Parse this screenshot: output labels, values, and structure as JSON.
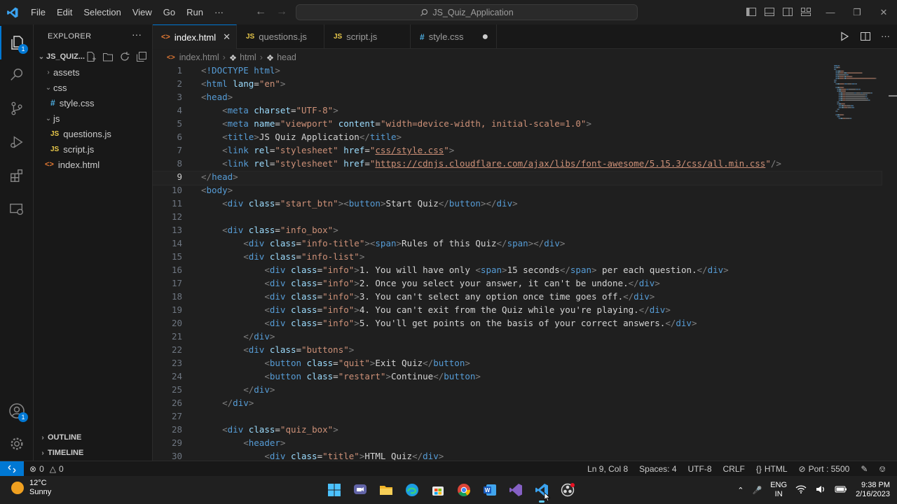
{
  "titlebar": {
    "menu": [
      "File",
      "Edit",
      "Selection",
      "View",
      "Go",
      "Run",
      "···"
    ],
    "search": "JS_Quiz_Application"
  },
  "activity": {
    "explorer_badge": "1",
    "account_badge": "1"
  },
  "explorer": {
    "title": "EXPLORER",
    "project": "JS_QUIZ...",
    "items": [
      {
        "label": "assets",
        "kind": "folder",
        "open": false,
        "depth": 1
      },
      {
        "label": "css",
        "kind": "folder",
        "open": true,
        "depth": 1
      },
      {
        "label": "style.css",
        "kind": "css",
        "depth": 2
      },
      {
        "label": "js",
        "kind": "folder",
        "open": true,
        "depth": 1
      },
      {
        "label": "questions.js",
        "kind": "js",
        "depth": 2
      },
      {
        "label": "script.js",
        "kind": "js",
        "depth": 2
      },
      {
        "label": "index.html",
        "kind": "html",
        "depth": 1
      }
    ],
    "outline": "OUTLINE",
    "timeline": "TIMELINE"
  },
  "tabs": [
    {
      "label": "index.html",
      "kind": "html",
      "active": true
    },
    {
      "label": "questions.js",
      "kind": "js"
    },
    {
      "label": "script.js",
      "kind": "js"
    },
    {
      "label": "style.css",
      "kind": "css",
      "dirty": true
    }
  ],
  "breadcrumbs": [
    "index.html",
    "html",
    "head"
  ],
  "editor": {
    "current_line": 9,
    "lines": [
      [
        [
          "tag",
          "<"
        ],
        [
          "name",
          "!DOCTYPE"
        ],
        [
          "txt",
          " "
        ],
        [
          "name",
          "html"
        ],
        [
          "tag",
          ">"
        ]
      ],
      [
        [
          "tag",
          "<"
        ],
        [
          "name",
          "html"
        ],
        [
          "txt",
          " "
        ],
        [
          "attr",
          "lang"
        ],
        [
          "txt",
          "="
        ],
        [
          "val",
          "\"en\""
        ],
        [
          "tag",
          ">"
        ]
      ],
      [
        [
          "tag",
          "<"
        ],
        [
          "name",
          "head"
        ],
        [
          "tag",
          ">"
        ]
      ],
      [
        [
          "txt",
          "    "
        ],
        [
          "tag",
          "<"
        ],
        [
          "name",
          "meta"
        ],
        [
          "txt",
          " "
        ],
        [
          "attr",
          "charset"
        ],
        [
          "txt",
          "="
        ],
        [
          "val",
          "\"UTF-8\""
        ],
        [
          "tag",
          ">"
        ]
      ],
      [
        [
          "txt",
          "    "
        ],
        [
          "tag",
          "<"
        ],
        [
          "name",
          "meta"
        ],
        [
          "txt",
          " "
        ],
        [
          "attr",
          "name"
        ],
        [
          "txt",
          "="
        ],
        [
          "val",
          "\"viewport\""
        ],
        [
          "txt",
          " "
        ],
        [
          "attr",
          "content"
        ],
        [
          "txt",
          "="
        ],
        [
          "val",
          "\"width=device-width, initial-scale=1.0\""
        ],
        [
          "tag",
          ">"
        ]
      ],
      [
        [
          "txt",
          "    "
        ],
        [
          "tag",
          "<"
        ],
        [
          "name",
          "title"
        ],
        [
          "tag",
          ">"
        ],
        [
          "txt",
          "JS Quiz Application"
        ],
        [
          "tag",
          "</"
        ],
        [
          "name",
          "title"
        ],
        [
          "tag",
          ">"
        ]
      ],
      [
        [
          "txt",
          "    "
        ],
        [
          "tag",
          "<"
        ],
        [
          "name",
          "link"
        ],
        [
          "txt",
          " "
        ],
        [
          "attr",
          "rel"
        ],
        [
          "txt",
          "="
        ],
        [
          "val",
          "\"stylesheet\""
        ],
        [
          "txt",
          " "
        ],
        [
          "attr",
          "href"
        ],
        [
          "txt",
          "="
        ],
        [
          "val",
          "\""
        ],
        [
          "valu",
          "css/style.css"
        ],
        [
          "val",
          "\""
        ],
        [
          "tag",
          ">"
        ]
      ],
      [
        [
          "txt",
          "    "
        ],
        [
          "tag",
          "<"
        ],
        [
          "name",
          "link"
        ],
        [
          "txt",
          " "
        ],
        [
          "attr",
          "rel"
        ],
        [
          "txt",
          "="
        ],
        [
          "val",
          "\"stylesheet\""
        ],
        [
          "txt",
          " "
        ],
        [
          "attr",
          "href"
        ],
        [
          "txt",
          "="
        ],
        [
          "val",
          "\""
        ],
        [
          "valu",
          "https://cdnjs.cloudflare.com/ajax/libs/font-awesome/5.15.3/css/all.min.css"
        ],
        [
          "val",
          "\""
        ],
        [
          "tag",
          "/>"
        ]
      ],
      [
        [
          "tag",
          "</"
        ],
        [
          "name",
          "head"
        ],
        [
          "tag",
          ">"
        ]
      ],
      [
        [
          "tag",
          "<"
        ],
        [
          "name",
          "body"
        ],
        [
          "tag",
          ">"
        ]
      ],
      [
        [
          "txt",
          "    "
        ],
        [
          "tag",
          "<"
        ],
        [
          "name",
          "div"
        ],
        [
          "txt",
          " "
        ],
        [
          "attr",
          "class"
        ],
        [
          "txt",
          "="
        ],
        [
          "val",
          "\"start_btn\""
        ],
        [
          "tag",
          "><"
        ],
        [
          "name",
          "button"
        ],
        [
          "tag",
          ">"
        ],
        [
          "txt",
          "Start Quiz"
        ],
        [
          "tag",
          "</"
        ],
        [
          "name",
          "button"
        ],
        [
          "tag",
          "></"
        ],
        [
          "name",
          "div"
        ],
        [
          "tag",
          ">"
        ]
      ],
      [],
      [
        [
          "txt",
          "    "
        ],
        [
          "tag",
          "<"
        ],
        [
          "name",
          "div"
        ],
        [
          "txt",
          " "
        ],
        [
          "attr",
          "class"
        ],
        [
          "txt",
          "="
        ],
        [
          "val",
          "\"info_box\""
        ],
        [
          "tag",
          ">"
        ]
      ],
      [
        [
          "txt",
          "        "
        ],
        [
          "tag",
          "<"
        ],
        [
          "name",
          "div"
        ],
        [
          "txt",
          " "
        ],
        [
          "attr",
          "class"
        ],
        [
          "txt",
          "="
        ],
        [
          "val",
          "\"info-title\""
        ],
        [
          "tag",
          "><"
        ],
        [
          "name",
          "span"
        ],
        [
          "tag",
          ">"
        ],
        [
          "txt",
          "Rules of this Quiz"
        ],
        [
          "tag",
          "</"
        ],
        [
          "name",
          "span"
        ],
        [
          "tag",
          "></"
        ],
        [
          "name",
          "div"
        ],
        [
          "tag",
          ">"
        ]
      ],
      [
        [
          "txt",
          "        "
        ],
        [
          "tag",
          "<"
        ],
        [
          "name",
          "div"
        ],
        [
          "txt",
          " "
        ],
        [
          "attr",
          "class"
        ],
        [
          "txt",
          "="
        ],
        [
          "val",
          "\"info-list\""
        ],
        [
          "tag",
          ">"
        ]
      ],
      [
        [
          "txt",
          "            "
        ],
        [
          "tag",
          "<"
        ],
        [
          "name",
          "div"
        ],
        [
          "txt",
          " "
        ],
        [
          "attr",
          "class"
        ],
        [
          "txt",
          "="
        ],
        [
          "val",
          "\"info\""
        ],
        [
          "tag",
          ">"
        ],
        [
          "txt",
          "1. You will have only "
        ],
        [
          "tag",
          "<"
        ],
        [
          "name",
          "span"
        ],
        [
          "tag",
          ">"
        ],
        [
          "txt",
          "15 seconds"
        ],
        [
          "tag",
          "</"
        ],
        [
          "name",
          "span"
        ],
        [
          "tag",
          ">"
        ],
        [
          "txt",
          " per each question."
        ],
        [
          "tag",
          "</"
        ],
        [
          "name",
          "div"
        ],
        [
          "tag",
          ">"
        ]
      ],
      [
        [
          "txt",
          "            "
        ],
        [
          "tag",
          "<"
        ],
        [
          "name",
          "div"
        ],
        [
          "txt",
          " "
        ],
        [
          "attr",
          "class"
        ],
        [
          "txt",
          "="
        ],
        [
          "val",
          "\"info\""
        ],
        [
          "tag",
          ">"
        ],
        [
          "txt",
          "2. Once you select your answer, it can't be undone."
        ],
        [
          "tag",
          "</"
        ],
        [
          "name",
          "div"
        ],
        [
          "tag",
          ">"
        ]
      ],
      [
        [
          "txt",
          "            "
        ],
        [
          "tag",
          "<"
        ],
        [
          "name",
          "div"
        ],
        [
          "txt",
          " "
        ],
        [
          "attr",
          "class"
        ],
        [
          "txt",
          "="
        ],
        [
          "val",
          "\"info\""
        ],
        [
          "tag",
          ">"
        ],
        [
          "txt",
          "3. You can't select any option once time goes off."
        ],
        [
          "tag",
          "</"
        ],
        [
          "name",
          "div"
        ],
        [
          "tag",
          ">"
        ]
      ],
      [
        [
          "txt",
          "            "
        ],
        [
          "tag",
          "<"
        ],
        [
          "name",
          "div"
        ],
        [
          "txt",
          " "
        ],
        [
          "attr",
          "class"
        ],
        [
          "txt",
          "="
        ],
        [
          "val",
          "\"info\""
        ],
        [
          "tag",
          ">"
        ],
        [
          "txt",
          "4. You can't exit from the Quiz while you're playing."
        ],
        [
          "tag",
          "</"
        ],
        [
          "name",
          "div"
        ],
        [
          "tag",
          ">"
        ]
      ],
      [
        [
          "txt",
          "            "
        ],
        [
          "tag",
          "<"
        ],
        [
          "name",
          "div"
        ],
        [
          "txt",
          " "
        ],
        [
          "attr",
          "class"
        ],
        [
          "txt",
          "="
        ],
        [
          "val",
          "\"info\""
        ],
        [
          "tag",
          ">"
        ],
        [
          "txt",
          "5. You'll get points on the basis of your correct answers."
        ],
        [
          "tag",
          "</"
        ],
        [
          "name",
          "div"
        ],
        [
          "tag",
          ">"
        ]
      ],
      [
        [
          "txt",
          "        "
        ],
        [
          "tag",
          "</"
        ],
        [
          "name",
          "div"
        ],
        [
          "tag",
          ">"
        ]
      ],
      [
        [
          "txt",
          "        "
        ],
        [
          "tag",
          "<"
        ],
        [
          "name",
          "div"
        ],
        [
          "txt",
          " "
        ],
        [
          "attr",
          "class"
        ],
        [
          "txt",
          "="
        ],
        [
          "val",
          "\"buttons\""
        ],
        [
          "tag",
          ">"
        ]
      ],
      [
        [
          "txt",
          "            "
        ],
        [
          "tag",
          "<"
        ],
        [
          "name",
          "button"
        ],
        [
          "txt",
          " "
        ],
        [
          "attr",
          "class"
        ],
        [
          "txt",
          "="
        ],
        [
          "val",
          "\"quit\""
        ],
        [
          "tag",
          ">"
        ],
        [
          "txt",
          "Exit Quiz"
        ],
        [
          "tag",
          "</"
        ],
        [
          "name",
          "button"
        ],
        [
          "tag",
          ">"
        ]
      ],
      [
        [
          "txt",
          "            "
        ],
        [
          "tag",
          "<"
        ],
        [
          "name",
          "button"
        ],
        [
          "txt",
          " "
        ],
        [
          "attr",
          "class"
        ],
        [
          "txt",
          "="
        ],
        [
          "val",
          "\"restart\""
        ],
        [
          "tag",
          ">"
        ],
        [
          "txt",
          "Continue"
        ],
        [
          "tag",
          "</"
        ],
        [
          "name",
          "button"
        ],
        [
          "tag",
          ">"
        ]
      ],
      [
        [
          "txt",
          "        "
        ],
        [
          "tag",
          "</"
        ],
        [
          "name",
          "div"
        ],
        [
          "tag",
          ">"
        ]
      ],
      [
        [
          "txt",
          "    "
        ],
        [
          "tag",
          "</"
        ],
        [
          "name",
          "div"
        ],
        [
          "tag",
          ">"
        ]
      ],
      [],
      [
        [
          "txt",
          "    "
        ],
        [
          "tag",
          "<"
        ],
        [
          "name",
          "div"
        ],
        [
          "txt",
          " "
        ],
        [
          "attr",
          "class"
        ],
        [
          "txt",
          "="
        ],
        [
          "val",
          "\"quiz_box\""
        ],
        [
          "tag",
          ">"
        ]
      ],
      [
        [
          "txt",
          "        "
        ],
        [
          "tag",
          "<"
        ],
        [
          "name",
          "header"
        ],
        [
          "tag",
          ">"
        ]
      ],
      [
        [
          "txt",
          "            "
        ],
        [
          "tag",
          "<"
        ],
        [
          "name",
          "div"
        ],
        [
          "txt",
          " "
        ],
        [
          "attr",
          "class"
        ],
        [
          "txt",
          "="
        ],
        [
          "val",
          "\"title\""
        ],
        [
          "tag",
          ">"
        ],
        [
          "txt",
          "HTML Quiz"
        ],
        [
          "tag",
          "</"
        ],
        [
          "name",
          "div"
        ],
        [
          "tag",
          ">"
        ]
      ]
    ]
  },
  "status": {
    "errors": "0",
    "warnings": "0",
    "position": "Ln 9, Col 8",
    "spaces": "Spaces: 4",
    "encoding": "UTF-8",
    "eol": "CRLF",
    "language": "HTML",
    "port": "Port : 5500"
  },
  "taskbar": {
    "temp": "12°C",
    "weather": "Sunny",
    "lang1": "ENG",
    "lang2": "IN",
    "time": "9:38 PM",
    "date": "2/16/2023"
  },
  "colors": {
    "accent": "#0078d4",
    "editor_bg": "#1f1f1f",
    "sidebar_bg": "#181818"
  }
}
